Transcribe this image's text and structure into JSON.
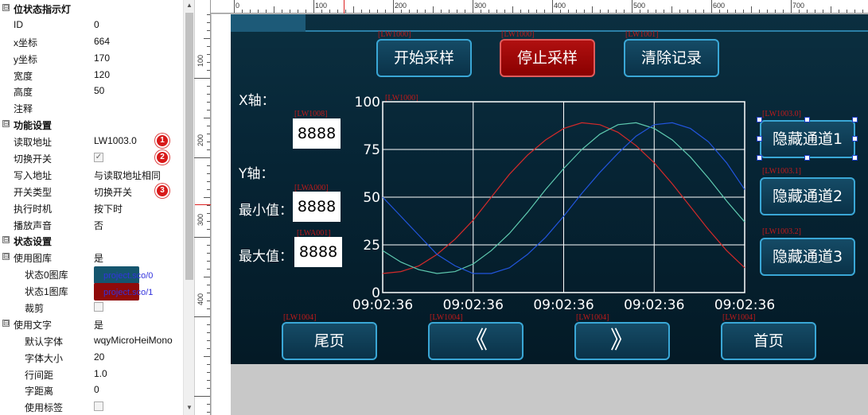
{
  "props": {
    "rows": [
      {
        "kind": "section",
        "key": "位状态指示灯",
        "toggle": "⊟"
      },
      {
        "kind": "field",
        "key": "ID",
        "value": "0"
      },
      {
        "kind": "field",
        "key": "x坐标",
        "value": "664"
      },
      {
        "kind": "field",
        "key": "y坐标",
        "value": "170"
      },
      {
        "kind": "field",
        "key": "宽度",
        "value": "120"
      },
      {
        "kind": "field",
        "key": "高度",
        "value": "50"
      },
      {
        "kind": "field",
        "key": "注释",
        "value": ""
      },
      {
        "kind": "section",
        "key": "功能设置",
        "toggle": "⊟"
      },
      {
        "kind": "field",
        "key": "读取地址",
        "value": "LW1003.0",
        "badge": "1"
      },
      {
        "kind": "check",
        "key": "切换开关",
        "checked": true,
        "badge": "2"
      },
      {
        "kind": "field",
        "key": "写入地址",
        "value": "与读取地址相同"
      },
      {
        "kind": "field",
        "key": "开关类型",
        "value": "切换开关",
        "badge": "3"
      },
      {
        "kind": "field",
        "key": "执行时机",
        "value": "按下时"
      },
      {
        "kind": "field",
        "key": "播放声音",
        "value": "否"
      },
      {
        "kind": "section",
        "key": "状态设置",
        "toggle": "⊟"
      },
      {
        "kind": "field",
        "key": "使用图库",
        "value": "是",
        "toggle": "⊟"
      },
      {
        "kind": "swatch",
        "key": "状态0图库",
        "value": "project.sco/0",
        "color": "#15556e",
        "sub": true
      },
      {
        "kind": "swatch",
        "key": "状态1图库",
        "value": "project.sco/1",
        "color": "#8f0a0a",
        "sub": true
      },
      {
        "kind": "check",
        "key": "裁剪",
        "checked": false,
        "sub": true
      },
      {
        "kind": "field",
        "key": "使用文字",
        "value": "是",
        "toggle": "⊟"
      },
      {
        "kind": "field",
        "key": "默认字体",
        "value": "wqyMicroHeiMono",
        "sub": true
      },
      {
        "kind": "field",
        "key": "字体大小",
        "value": "20",
        "sub": true
      },
      {
        "kind": "field",
        "key": "行间距",
        "value": "1.0",
        "sub": true
      },
      {
        "kind": "field",
        "key": "字距离",
        "value": "0",
        "sub": true
      },
      {
        "kind": "check",
        "key": "使用标签",
        "checked": false,
        "sub": true
      }
    ]
  },
  "ruler": {
    "h_labels": [
      "0",
      "100",
      "200",
      "300",
      "400",
      "500",
      "600",
      "700"
    ],
    "v_labels": [
      "100",
      "200",
      "300",
      "400"
    ]
  },
  "canvas": {
    "top_buttons": [
      {
        "name": "start-sample-button",
        "label": "开始采样",
        "tag": "[LW1000]",
        "style": "blue"
      },
      {
        "name": "stop-sample-button",
        "label": "停止采样",
        "tag": "[LW1000]",
        "style": "red"
      },
      {
        "name": "clear-records-button",
        "label": "清除记录",
        "tag": "[LW1001]",
        "style": "blue"
      }
    ],
    "x_axis_label": "X轴：",
    "y_axis_label": "Y轴：",
    "min_label": "最小值：",
    "max_label": "最大值：",
    "num_x": {
      "value": "8888",
      "tag": "[LW1008]"
    },
    "num_min": {
      "value": "8888",
      "tag": "[LWA000]"
    },
    "num_max": {
      "value": "8888",
      "tag": "[LWA001]"
    },
    "chart_tag": "[LW1000]",
    "channel_buttons": [
      {
        "name": "hide-channel-1-button",
        "label": "隐藏通道1",
        "tag": "[LW1003.0]"
      },
      {
        "name": "hide-channel-2-button",
        "label": "隐藏通道2",
        "tag": "[LW1003.1]"
      },
      {
        "name": "hide-channel-3-button",
        "label": "隐藏通道3",
        "tag": "[LW1003.2]"
      }
    ],
    "nav_buttons": [
      {
        "name": "last-page-button",
        "label": "尾页",
        "tag": "[LW1004]",
        "icon": "text"
      },
      {
        "name": "prev-page-button",
        "label": "",
        "tag": "[LW1004]",
        "icon": "double-chevron-left-icon"
      },
      {
        "name": "next-page-button",
        "label": "",
        "tag": "[LW1004]",
        "icon": "double-chevron-right-icon"
      },
      {
        "name": "first-page-button",
        "label": "首页",
        "tag": "[LW1004]",
        "icon": "text"
      }
    ]
  },
  "chart_data": {
    "type": "line",
    "title": "",
    "xlabel": "",
    "ylabel": "",
    "ylim": [
      0,
      100
    ],
    "y_ticks": [
      "0",
      "25",
      "50",
      "75",
      "100"
    ],
    "x_ticks": [
      "09:02:36",
      "09:02:36",
      "09:02:36",
      "09:02:36",
      "09:02:36"
    ],
    "grid": true,
    "x": [
      0,
      0.05,
      0.1,
      0.15,
      0.2,
      0.25,
      0.3,
      0.35,
      0.4,
      0.45,
      0.5,
      0.55,
      0.6,
      0.65,
      0.7,
      0.75,
      0.8,
      0.85,
      0.9,
      0.95,
      1
    ],
    "series": [
      {
        "color": "#d42a2a",
        "values": [
          10,
          11,
          14,
          20,
          28,
          38,
          50,
          62,
          72,
          80,
          86,
          89,
          88,
          84,
          77,
          68,
          57,
          45,
          33,
          22,
          13
        ]
      },
      {
        "color": "#5fcab0",
        "values": [
          22,
          16,
          12,
          10,
          11,
          15,
          22,
          31,
          42,
          54,
          65,
          75,
          83,
          88,
          89,
          86,
          80,
          71,
          60,
          48,
          37
        ]
      },
      {
        "color": "#2255dd",
        "values": [
          50,
          40,
          30,
          20,
          14,
          10,
          10,
          13,
          20,
          29,
          40,
          52,
          63,
          73,
          82,
          88,
          89,
          86,
          79,
          68,
          54
        ]
      }
    ]
  }
}
